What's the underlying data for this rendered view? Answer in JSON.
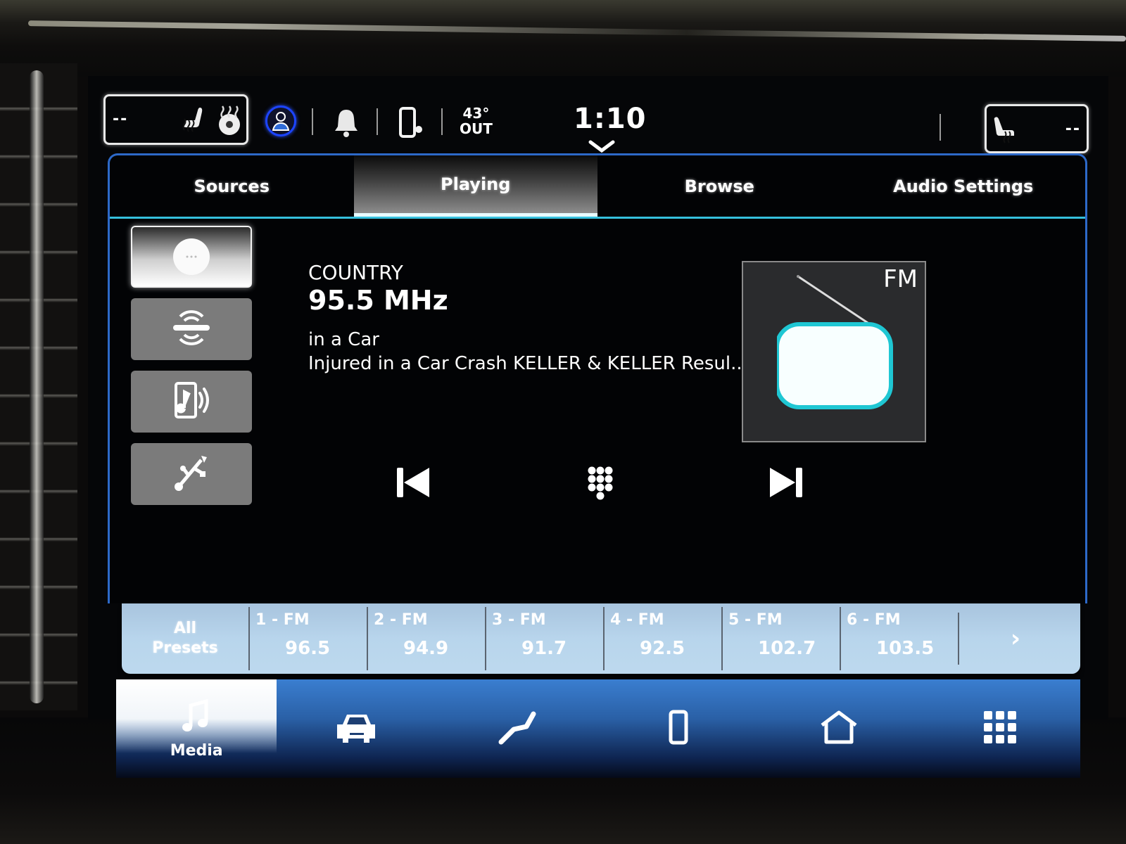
{
  "status_bar": {
    "left_climate": {
      "value": "--",
      "icons": [
        "heated-seat-icon",
        "heated-steering-wheel-icon"
      ]
    },
    "right_climate": {
      "value": "--",
      "icons": [
        "heated-seat-icon"
      ]
    },
    "profile_icon": "driver-profile-icon",
    "notification_icon": "bell-icon",
    "phone_icon": "phone-status-icon",
    "temperature": "43°",
    "temperature_label": "OUT",
    "clock": "1:10",
    "expand_icon": "chevron-down-icon"
  },
  "tabs": [
    {
      "label": "Sources",
      "active": false
    },
    {
      "label": "Playing",
      "active": true
    },
    {
      "label": "Browse",
      "active": false
    },
    {
      "label": "Audio Settings",
      "active": false
    }
  ],
  "sources": [
    {
      "name": "radio",
      "icon": "radio-source-icon",
      "active": true
    },
    {
      "name": "satellite-radio",
      "icon": "satellite-radio-icon",
      "active": false
    },
    {
      "name": "bluetooth-audio",
      "icon": "bluetooth-audio-icon",
      "active": false
    },
    {
      "name": "usb",
      "icon": "usb-icon",
      "active": false
    }
  ],
  "now_playing": {
    "genre": "COUNTRY",
    "frequency": "95.5 MHz",
    "line1": "in a Car",
    "line2": "Injured in a Car Crash KELLER & KELLER Resul..."
  },
  "album_art": {
    "band": "FM",
    "icon": "radio-icon"
  },
  "controls": {
    "prev_icon": "skip-previous-icon",
    "keypad_icon": "direct-tune-keypad-icon",
    "next_icon": "skip-next-icon"
  },
  "presets": {
    "all_label_1": "All",
    "all_label_2": "Presets",
    "items": [
      {
        "label": "1 - FM",
        "freq": "96.5"
      },
      {
        "label": "2 - FM",
        "freq": "94.9"
      },
      {
        "label": "3 - FM",
        "freq": "91.7"
      },
      {
        "label": "4 - FM",
        "freq": "92.5"
      },
      {
        "label": "5 - FM",
        "freq": "102.7"
      },
      {
        "label": "6 - FM",
        "freq": "103.5"
      }
    ],
    "next_glyph": "›"
  },
  "bottom_nav": [
    {
      "name": "media",
      "label": "Media",
      "icon": "music-note-icon",
      "active": true
    },
    {
      "name": "vehicle",
      "label": "",
      "icon": "car-icon",
      "active": false
    },
    {
      "name": "comfort",
      "label": "",
      "icon": "seat-icon",
      "active": false
    },
    {
      "name": "phone",
      "label": "",
      "icon": "phone-icon",
      "active": false
    },
    {
      "name": "home",
      "label": "",
      "icon": "home-icon",
      "active": false
    },
    {
      "name": "apps",
      "label": "",
      "icon": "apps-grid-icon",
      "active": false
    }
  ],
  "colors": {
    "accent_blue": "#2d69c8",
    "tab_underline": "#35c0dd",
    "presets_bg": "#b8d5ec",
    "profile_ring": "#1c44ff"
  }
}
